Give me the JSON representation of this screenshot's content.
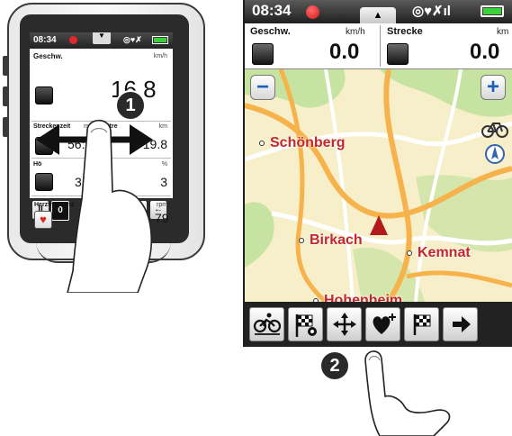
{
  "left_device": {
    "status": {
      "time": "08:34"
    },
    "speed": {
      "label": "Geschw.",
      "unit": "km/h",
      "value": "16.8"
    },
    "row1": [
      {
        "label": "Streckenzeit",
        "unit": "m:s",
        "value": "56:35"
      },
      {
        "label": "Stre",
        "unit": "km",
        "value": "19.8"
      }
    ],
    "row2": [
      {
        "label": "Hö",
        "value": "3"
      },
      {
        "label": "",
        "unit": "%",
        "value": "3"
      }
    ],
    "row3": [
      {
        "label": "Herzfrequenz",
        "value": ""
      },
      {
        "label": "denz",
        "unit": "rpm",
        "value": "79"
      }
    ],
    "toolbar": [
      "II",
      "0",
      "",
      "",
      "",
      "←"
    ],
    "gesture_step": "1"
  },
  "right_device": {
    "status": {
      "time": "08:34",
      "icons": "◎♥✗ıl"
    },
    "fields": [
      {
        "label": "Geschw.",
        "unit": "km/h",
        "value": "0.0"
      },
      {
        "label": "Strecke",
        "unit": "km",
        "value": "0.0"
      }
    ],
    "map": {
      "zoom_out": "−",
      "zoom_in": "+",
      "places": [
        "Schönberg",
        "Birkach",
        "Kemnat",
        "Hohenheim"
      ],
      "colors": {
        "land": "#f7efc9",
        "forest": "#c6e3a1",
        "major_road": "#f6b24b",
        "minor_road": "#ffffff",
        "position_marker": "#b31b1b"
      }
    },
    "toolbar": [
      "cycle-profile-icon",
      "checkered-flag-gear-icon",
      "move-arrows-icon",
      "heart-plus-icon",
      "checkered-flag-icon",
      "arrow-right-icon"
    ],
    "gesture_step": "2"
  }
}
